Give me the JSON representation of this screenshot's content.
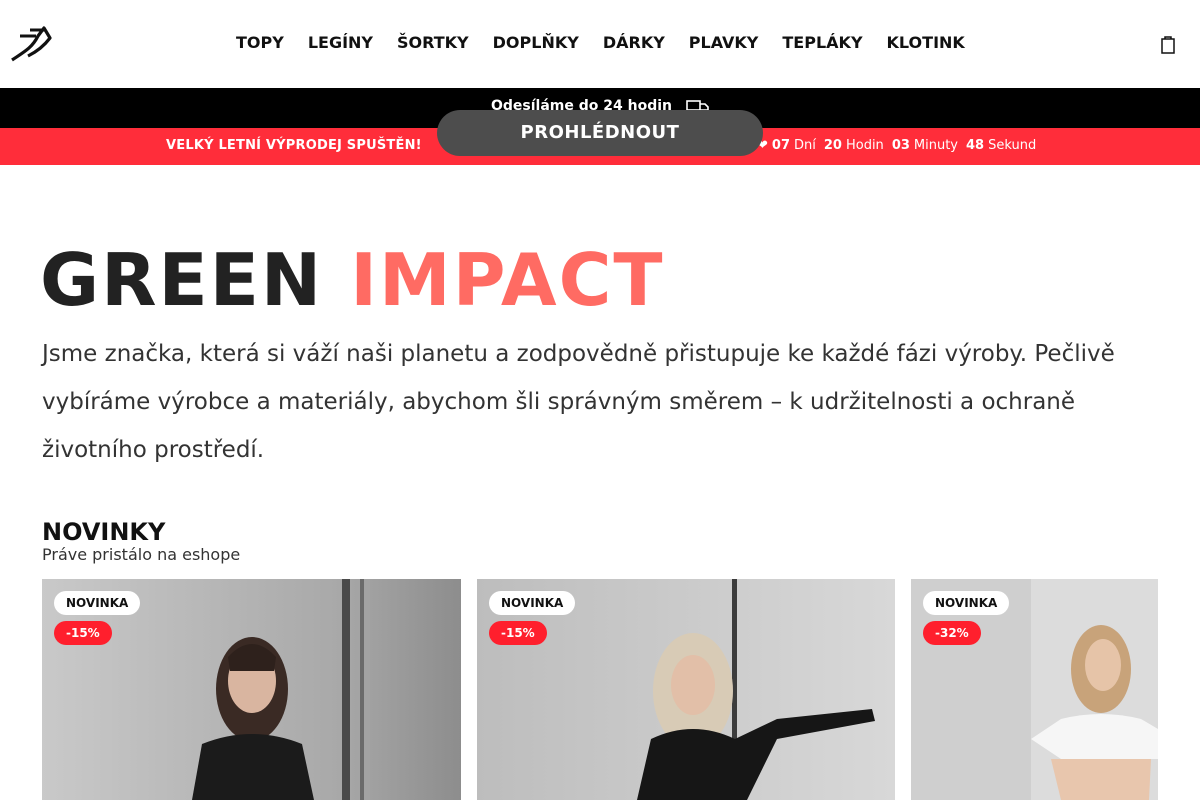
{
  "header": {
    "nav": [
      "TOPY",
      "LEGÍNY",
      "ŠORTKY",
      "DOPLŇKY",
      "DÁRKY",
      "PLAVKY",
      "TEPLÁKY",
      "KLOTINK"
    ],
    "cart_icon": "cart-icon",
    "logo_icon": "brand-logo"
  },
  "shipping_bar": {
    "text": "Odesíláme do 24 hodin",
    "icon": "truck-icon"
  },
  "sale_bar": {
    "left_text": "VELKÝ LETNÍ VÝPRODEJ SPUŠTĚN!",
    "heart": "❤",
    "days": "07",
    "days_label": "Dní",
    "hours": "20",
    "hours_label": "Hodin",
    "minutes": "03",
    "minutes_label": "Minuty",
    "seconds": "48",
    "seconds_label": "Sekund"
  },
  "cta": {
    "label": "PROHLÉDNOUT"
  },
  "hero": {
    "title_part1": "GREEN",
    "title_part2": "IMPACT",
    "text": "Jsme značka, která si váží naši planetu a zodpovědně přistupuje ke každé fázi výroby. Pečlivě vybíráme výrobce a materiály, abychom šli správným směrem – k udržitelnosti a ochraně životního prostředí."
  },
  "new_section": {
    "title": "NOVINKY",
    "subtitle": "Práve pristálo na eshope",
    "products": [
      {
        "badge_new": "NOVINKA ",
        "badge_sale": "-15%"
      },
      {
        "badge_new": "NOVINKA ",
        "badge_sale": "-15%"
      },
      {
        "badge_new": "NOVINKA ",
        "badge_sale": "-32%"
      }
    ]
  },
  "colors": {
    "accent": "#ff6b63",
    "sale_red": "#ff2d3a",
    "badge_red": "#ff1f2d",
    "black_bar": "#000000"
  }
}
